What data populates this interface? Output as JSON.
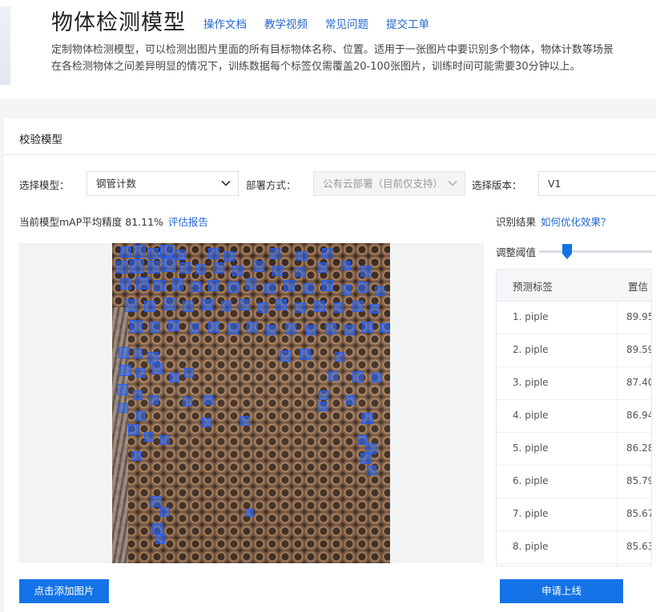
{
  "header": {
    "title": "物体检测模型",
    "links": [
      "操作文档",
      "教学视频",
      "常见问题",
      "提交工单"
    ],
    "desc_line1": "定制物体检测模型，可以检测出图片里面的所有目标物体名称、位置。适用于一张图片中要识别多个物体，物体计数等场景",
    "desc_line2": "在各检测物体之间差异明显的情况下，训练数据每个标签仅需覆盖20-100张图片，训练时间可能需要30分钟以上。"
  },
  "card": {
    "title": "校验模型",
    "model_label": "选择模型：",
    "model_value": "钢管计数",
    "deploy_label": "部署方式：",
    "deploy_value": "公有云部署（目前仅支持）",
    "version_label": "选择版本：",
    "version_value": "V1",
    "map_text": "当前模型mAP平均精度 81.11%",
    "report_link": "评估报告",
    "add_image_button": "点击添加图片"
  },
  "results": {
    "label": "识别结果",
    "optimize_link": "如何优化效果？",
    "threshold_label": "调整阈值",
    "threshold_value": 0.25,
    "col_label": "预测标签",
    "col_confidence": "置信",
    "rows": [
      {
        "label": "1. piple",
        "confidence": "89.95"
      },
      {
        "label": "2. piple",
        "confidence": "89.59"
      },
      {
        "label": "3. piple",
        "confidence": "87.40"
      },
      {
        "label": "4. piple",
        "confidence": "86.94"
      },
      {
        "label": "5. piple",
        "confidence": "86.28"
      },
      {
        "label": "6. piple",
        "confidence": "85.79"
      },
      {
        "label": "7. piple",
        "confidence": "85.67"
      },
      {
        "label": "8. piple",
        "confidence": "85.63"
      }
    ],
    "publish_button": "申请上线"
  },
  "colors": {
    "accent": "#1473e6",
    "link": "#2468d1",
    "detection_box": "#2d6eff"
  }
}
